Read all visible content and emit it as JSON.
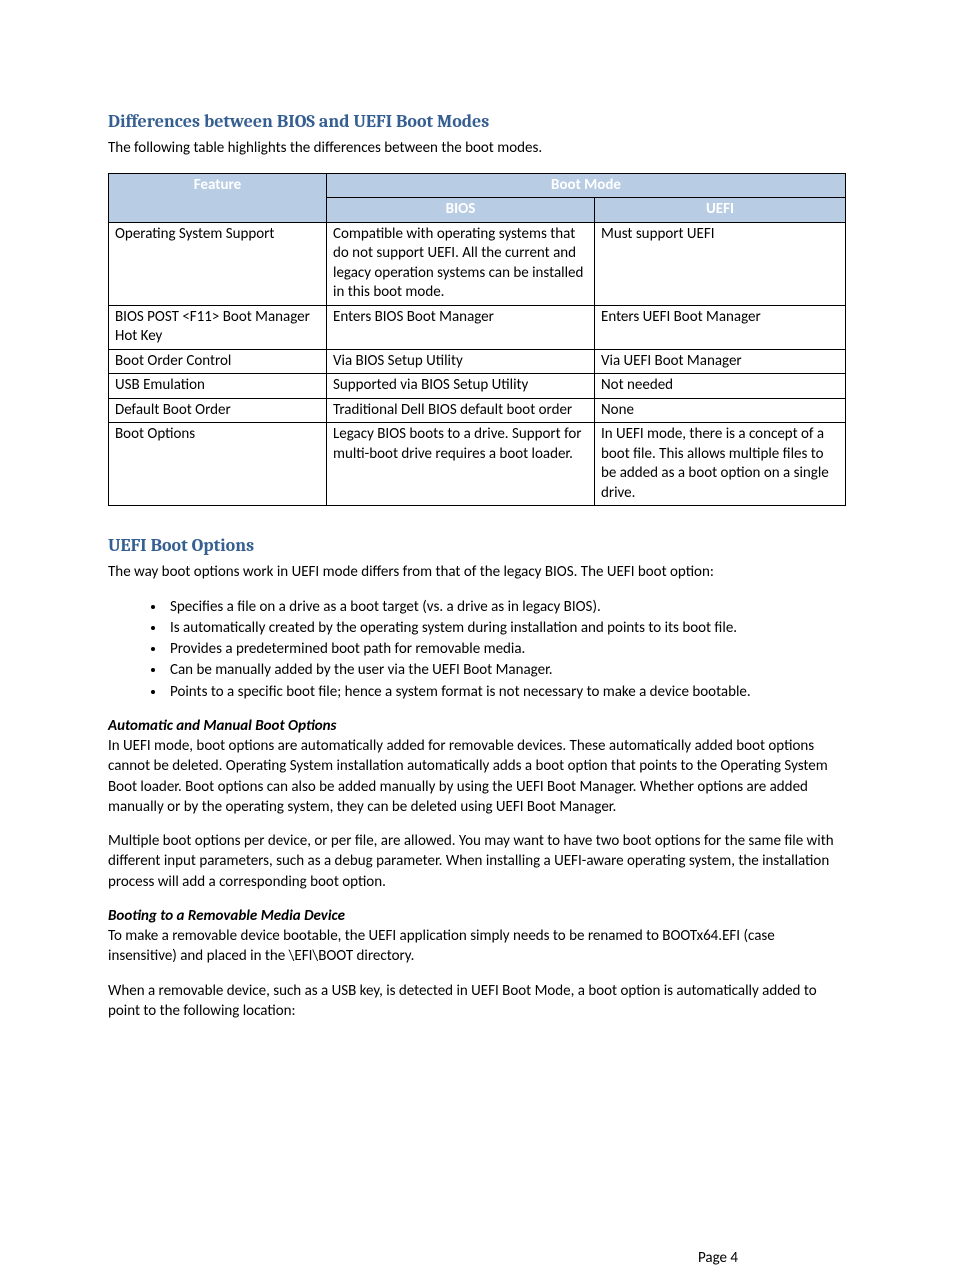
{
  "section1": {
    "heading": "Differences between BIOS and UEFI Boot Modes",
    "intro": "The following table highlights the differences between the boot modes."
  },
  "table": {
    "head": {
      "feature": "Feature",
      "bootmode": "Boot Mode",
      "bios": "BIOS",
      "uefi": "UEFI"
    },
    "rows": [
      {
        "feature": "Operating System Support",
        "bios": "Compatible with operating systems that do not support UEFI. All the current and legacy operation systems can be installed in this boot mode.",
        "uefi": "Must support UEFI"
      },
      {
        "feature": "BIOS POST <F11> Boot Manager Hot Key",
        "bios": "Enters BIOS Boot Manager",
        "uefi": "Enters UEFI Boot Manager"
      },
      {
        "feature": "Boot Order Control",
        "bios": "Via BIOS Setup Utility",
        "uefi": "Via UEFI Boot Manager"
      },
      {
        "feature": "USB Emulation",
        "bios": "Supported via BIOS Setup Utility",
        "uefi": "Not needed"
      },
      {
        "feature": "Default Boot Order",
        "bios": "Traditional Dell BIOS default boot order",
        "uefi": "None"
      },
      {
        "feature": "Boot Options",
        "bios": "Legacy BIOS boots to a drive.  Support for multi-boot drive requires a boot loader.",
        "uefi": "In UEFI mode, there is a concept of a boot file.  This allows multiple files to be added as a boot option on a single drive."
      }
    ]
  },
  "section2": {
    "heading": "UEFI Boot Options",
    "intro": "The way boot options work in UEFI mode differs from that of the legacy BIOS.  The UEFI boot option:",
    "bullets": [
      "Specifies a file on a drive as a boot target (vs. a drive as in legacy BIOS).",
      "Is automatically created by the operating system during installation and points to its boot file.",
      "Provides a predetermined boot path for removable media.",
      "Can be manually added by the user via the UEFI Boot Manager.",
      "Points to a specific boot file; hence a system format is not necessary to make a device bootable."
    ],
    "sub1_heading": "Automatic and Manual Boot Options",
    "sub1_p1": "In UEFI mode, boot options are automatically added for removable devices.  These automatically added boot options cannot be deleted.  Operating System installation automatically adds a boot option that points to the Operating System Boot loader. Boot options can also be added manually by using the UEFI Boot Manager. Whether options are added manually or by the operating system, they can be deleted using UEFI Boot Manager.",
    "sub1_p2": " Multiple boot options per device, or per file, are allowed.  You may want to have two boot options for the same file with different input parameters, such as a debug parameter.  When installing a UEFI-aware operating system, the installation process will add a corresponding boot option.",
    "sub2_heading": "Booting to a Removable Media Device",
    "sub2_p1": "To make a removable device bootable, the UEFI application simply needs to be renamed to BOOTx64.EFI (case insensitive) and placed in the \\EFI\\BOOT directory.",
    "sub2_p2": "When a removable device, such as a USB key, is detected in UEFI Boot Mode, a boot option is automatically added to point to the following location:"
  },
  "footer": {
    "page_label": "Page 4"
  }
}
